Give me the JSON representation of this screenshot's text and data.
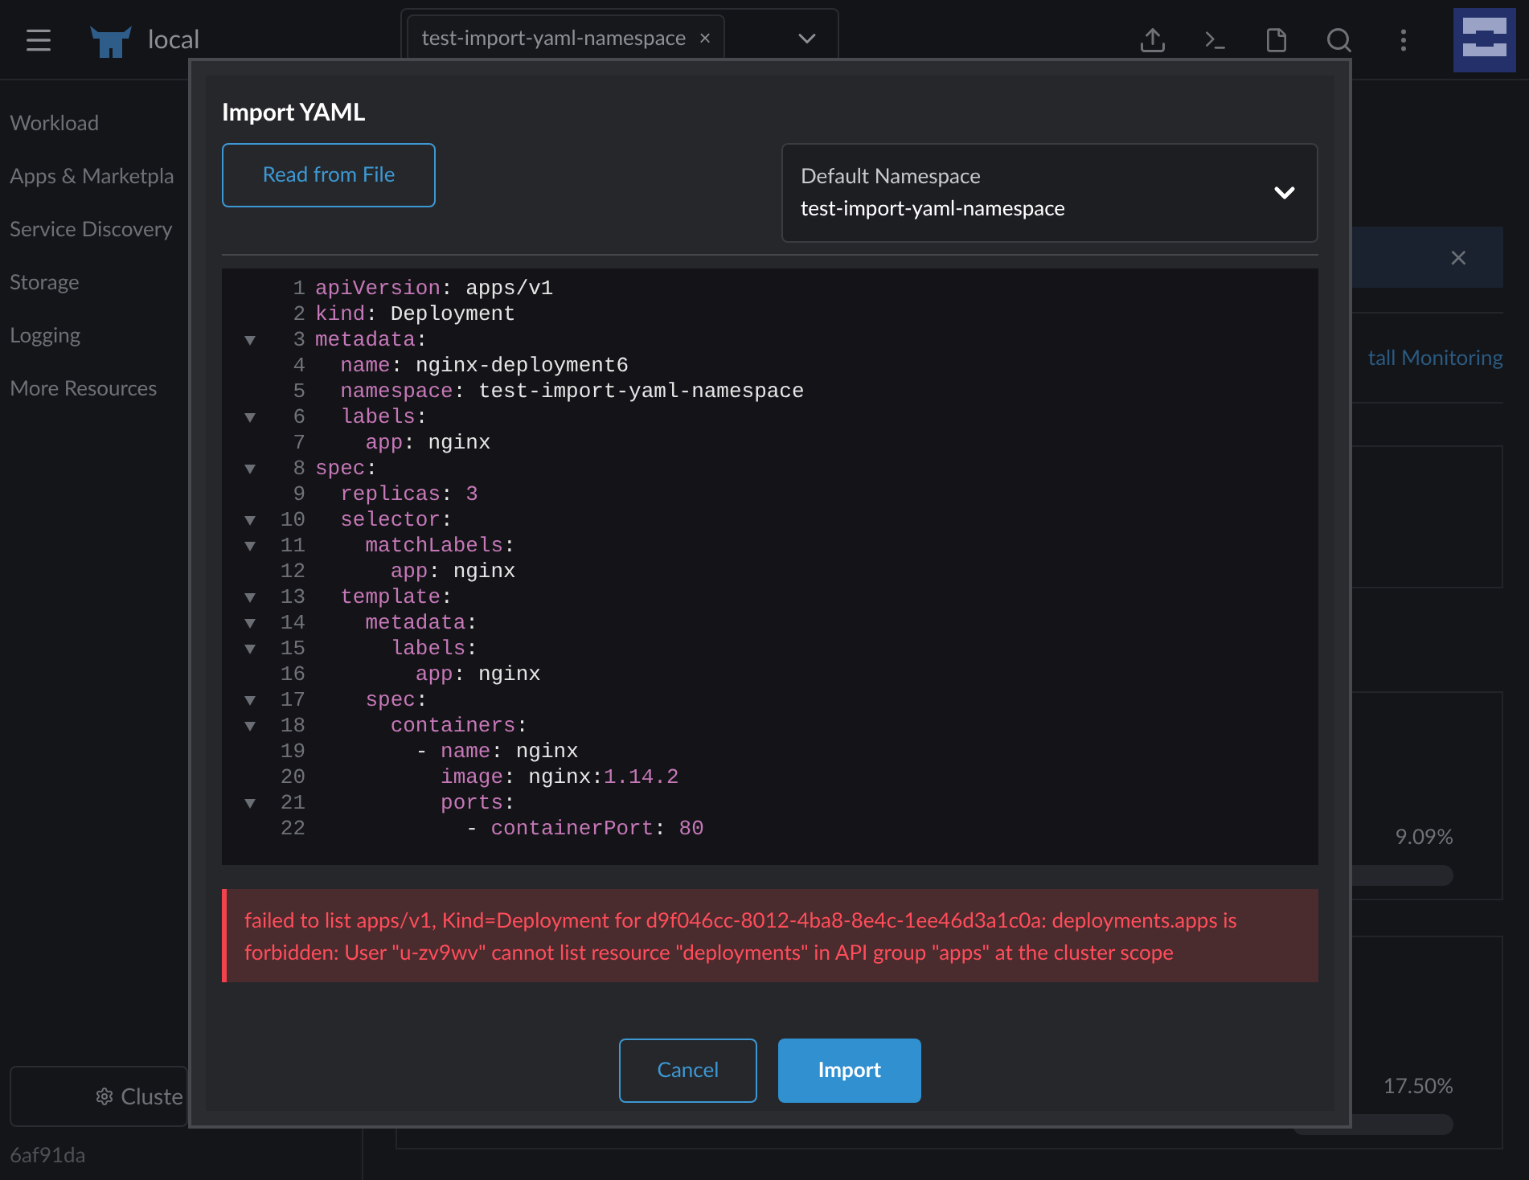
{
  "header": {
    "cluster": "local",
    "namespace_chip": "test-import-yaml-namespace",
    "chip_remove": "×"
  },
  "sidebar": {
    "items": [
      "Workload",
      "Apps & Marketpla",
      "Service Discovery",
      "Storage",
      "Logging",
      "More Resources"
    ],
    "cluster_button": "Cluste",
    "version": "6af91da"
  },
  "main": {
    "banner_close": "×",
    "monitoring_link": "tall Monitoring",
    "meters": [
      {
        "reading": "9.09%"
      },
      {
        "reading": "17.50%"
      }
    ]
  },
  "dialog": {
    "title": "Import YAML",
    "read_button": "Read from File",
    "namespace": {
      "label": "Default Namespace",
      "value": "test-import-yaml-namespace"
    },
    "code": [
      {
        "number": "1",
        "foldable": false,
        "text": "apiVersion: apps/v1"
      },
      {
        "number": "2",
        "foldable": false,
        "text": "kind: Deployment"
      },
      {
        "number": "3",
        "foldable": true,
        "text": "metadata:"
      },
      {
        "number": "4",
        "foldable": false,
        "text": "  name: nginx-deployment6"
      },
      {
        "number": "5",
        "foldable": false,
        "text": "  namespace: test-import-yaml-namespace"
      },
      {
        "number": "6",
        "foldable": true,
        "text": "  labels:"
      },
      {
        "number": "7",
        "foldable": false,
        "text": "    app: nginx"
      },
      {
        "number": "8",
        "foldable": true,
        "text": "spec:"
      },
      {
        "number": "9",
        "foldable": false,
        "text": "  replicas: 3"
      },
      {
        "number": "10",
        "foldable": true,
        "text": "  selector:"
      },
      {
        "number": "11",
        "foldable": true,
        "text": "    matchLabels:"
      },
      {
        "number": "12",
        "foldable": false,
        "text": "      app: nginx"
      },
      {
        "number": "13",
        "foldable": true,
        "text": "  template:"
      },
      {
        "number": "14",
        "foldable": true,
        "text": "    metadata:"
      },
      {
        "number": "15",
        "foldable": true,
        "text": "      labels:"
      },
      {
        "number": "16",
        "foldable": false,
        "text": "        app: nginx"
      },
      {
        "number": "17",
        "foldable": true,
        "text": "    spec:"
      },
      {
        "number": "18",
        "foldable": true,
        "text": "      containers:"
      },
      {
        "number": "19",
        "foldable": false,
        "text": "        - name: nginx"
      },
      {
        "number": "20",
        "foldable": false,
        "text": "          image: nginx:1.14.2"
      },
      {
        "number": "21",
        "foldable": true,
        "text": "          ports:"
      },
      {
        "number": "22",
        "foldable": false,
        "text": "            - containerPort: 80"
      }
    ],
    "error": "failed to list apps/v1, Kind=Deployment for d9f046cc-8012-4ba8-8e4c-1ee46d3a1c0a: deployments.apps is forbidden: User \"u-zv9wv\" cannot list resource \"deployments\" in API group \"apps\" at the cluster scope",
    "buttons": {
      "cancel": "Cancel",
      "import": "Import"
    }
  }
}
